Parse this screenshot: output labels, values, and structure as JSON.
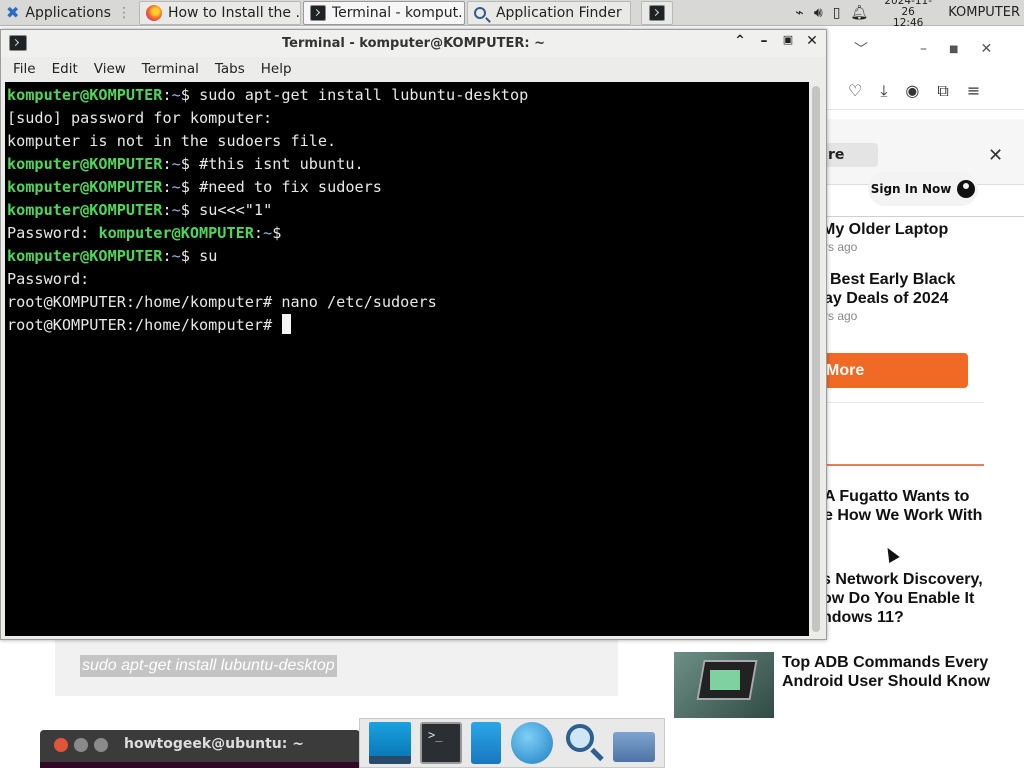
{
  "top_panel": {
    "apps_label": "Applications",
    "tasks": [
      {
        "label": "How to Install the ...",
        "icon": "firefox-icon"
      },
      {
        "label": "Terminal - komput...",
        "icon": "terminal-icon"
      },
      {
        "label": "Application Finder",
        "icon": "search-icon"
      }
    ],
    "clock_date": "2024-11-26",
    "clock_time": "12:46",
    "hostname": "KOMPUTER"
  },
  "terminal": {
    "title": "Terminal - komputer@KOMPUTER: ~",
    "menu": [
      "File",
      "Edit",
      "View",
      "Terminal",
      "Tabs",
      "Help"
    ],
    "user_host": "komputer@KOMPUTER",
    "path": "~",
    "root_prompt": "root@KOMPUTER:/home/komputer#",
    "lines": {
      "cmd1": " sudo apt-get install lubuntu-desktop",
      "out1": "[sudo] password for komputer:",
      "out2": "komputer is not in the sudoers file.",
      "cmd2": " #this isnt ubuntu.",
      "cmd3": " #need to fix sudoers",
      "cmd4": " su<<<\"1\"",
      "pw_label": "Password: ",
      "cmd5": " su",
      "pw_label2": "Password:",
      "cmd6": " nano /etc/sudoers"
    }
  },
  "browser": {
    "find_text": "re",
    "sign_in_label": "Sign In Now",
    "articles": [
      {
        "line1": "My Older Laptop",
        "ago": "rs ago"
      },
      {
        "line1": "Best Early Black",
        "line2": "ay Deals of 2024",
        "ago": "rs ago"
      }
    ],
    "more_label": "More",
    "news": [
      {
        "line1": "A Fugatto Wants to",
        "line2": "e How We Work With"
      },
      {
        "line1": "s Network Discovery,",
        "line2": "ow Do You Enable It",
        "line3": "ndows 11?"
      }
    ],
    "code_snippet": "sudo apt-get install lubuntu-desktop",
    "adb_title": "Top ADB Commands Every Android User Should Know",
    "embed_terminal_title": "howtogeek@ubuntu: ~"
  },
  "dock": {
    "items": [
      "desktop-icon",
      "terminal-icon",
      "file-manager-icon",
      "browser-globe-icon",
      "app-finder-icon",
      "folder-icon"
    ]
  }
}
